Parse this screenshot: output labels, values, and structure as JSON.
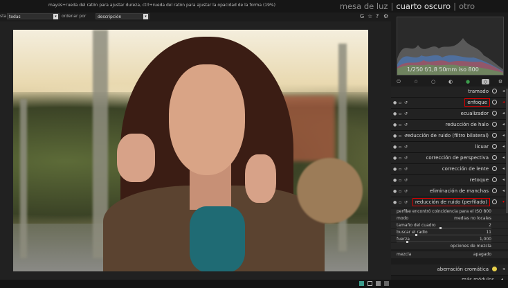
{
  "header": {
    "hint": "mayús+rueda del ratón para ajustar dureza, ctrl+rueda del ratón para ajustar la opacidad de la forma (19%)",
    "views": [
      "mesa de luz",
      "cuarto oscuro",
      "otro"
    ],
    "active_view": "cuarto oscuro",
    "separator": "|"
  },
  "filterbar": {
    "filter_label": "sta",
    "filter_value": "todas",
    "sort_label": "ordenar por",
    "sort_value": "descripción",
    "dropdown_glyph": "▾",
    "icons": [
      "G",
      "☆",
      "?",
      "⚙"
    ]
  },
  "histogram": {
    "info": "1/250 f/1,8 50mm iso 800"
  },
  "module_tabs": [
    "⏻",
    "☆",
    "○",
    "◐",
    "●",
    "◇",
    "⚙"
  ],
  "modules": [
    {
      "name": "tramado",
      "highlight": false,
      "controls": false
    },
    {
      "name": "enfoque",
      "highlight": true,
      "controls": true
    },
    {
      "name": "ecualizador",
      "highlight": false,
      "controls": true
    },
    {
      "name": "reducción de halo",
      "highlight": false,
      "controls": true
    },
    {
      "name": "reducción de ruido (filtro bilateral)",
      "highlight": false,
      "controls": true
    },
    {
      "name": "licuar",
      "highlight": false,
      "controls": true
    },
    {
      "name": "corrección de perspectiva",
      "highlight": false,
      "controls": true
    },
    {
      "name": "corrección de lente",
      "highlight": false,
      "controls": true
    },
    {
      "name": "retoque",
      "highlight": false,
      "controls": true
    },
    {
      "name": "eliminación de manchas",
      "highlight": false,
      "controls": true
    },
    {
      "name": "reducción de ruido (perfilado)",
      "highlight": true,
      "controls": true
    }
  ],
  "denoise_params": [
    {
      "key": "perfil",
      "value": "se encontró coincidencia para el ISO 800",
      "slider": false
    },
    {
      "key": "modo",
      "value": "medias no locales",
      "slider": false
    },
    {
      "key": "tamaño del cuadro",
      "value": "2",
      "slider": true,
      "level": 0.45
    },
    {
      "key": "buscar el radio",
      "value": "11",
      "slider": true,
      "level": 0.2
    },
    {
      "key": "fuerza",
      "value": "1,000",
      "slider": true,
      "level": 0.1
    },
    {
      "key": "",
      "value": "opciones de mezcla",
      "slider": false
    }
  ],
  "blend": {
    "key": "mezcla",
    "value": "apagado"
  },
  "last_module": "aberración cromática",
  "more_modules": "más módulos",
  "accent_red": "#dd0000"
}
